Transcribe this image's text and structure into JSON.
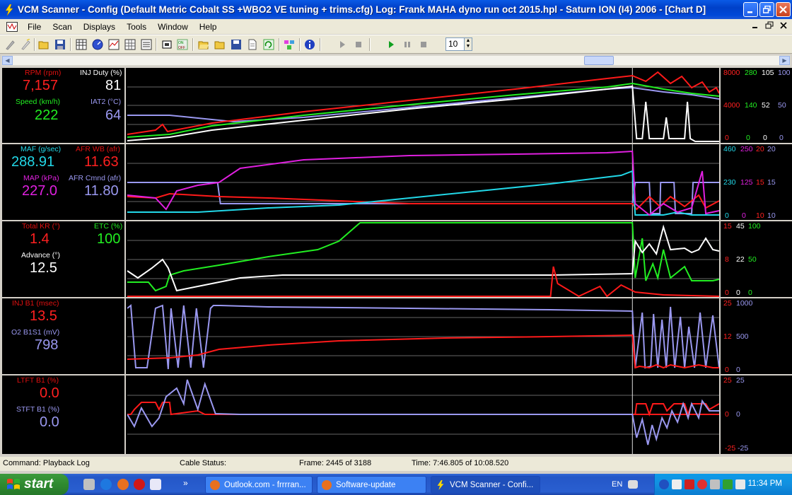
{
  "window": {
    "title": "VCM Scanner  -  Config  (Default Metric Cobalt SS +WBO2 VE tuning + trims.cfg)   Log:  Frank MAHA dyno run oct 2015.hpl   -  Saturn ION (I4) 2006 - [Chart D]"
  },
  "menu": [
    "File",
    "Scan",
    "Displays",
    "Tools",
    "Window",
    "Help"
  ],
  "toolbar": {
    "step_value": "10"
  },
  "colors": {
    "red": "#ff1a1a",
    "green": "#22ee22",
    "white": "#ffffff",
    "lavender": "#9a98f0",
    "cyan": "#22d8e8",
    "magenta": "#e020e0"
  },
  "panels": [
    {
      "readouts": [
        {
          "label": "RPM (rpm)",
          "value": "7,157",
          "color": "red"
        },
        {
          "label": "INJ Duty (%)",
          "value": "81",
          "color": "white"
        },
        {
          "label": "Speed (km/h)",
          "value": "222",
          "color": "green"
        },
        {
          "label": "IAT2 (°C)",
          "value": "64",
          "color": "lavender"
        }
      ],
      "scale": {
        "top": [
          "8000",
          "280",
          "105",
          "100"
        ],
        "mid": [
          "4000",
          "140",
          "52",
          "50"
        ],
        "bottom": [
          "0",
          "0",
          "0",
          "0"
        ]
      }
    },
    {
      "readouts": [
        {
          "label": "MAF (g/sec)",
          "value": "288.91",
          "color": "cyan"
        },
        {
          "label": "AFR WB (afr)",
          "value": "11.63",
          "color": "red"
        },
        {
          "label": "MAP (kPa)",
          "value": "227.0",
          "color": "magenta"
        },
        {
          "label": "AFR Cmnd (afr)",
          "value": "11.80",
          "color": "lavender"
        }
      ],
      "scale": {
        "top": [
          "460",
          "250",
          "20",
          "20"
        ],
        "mid": [
          "230",
          "125",
          "15",
          "15"
        ],
        "bottom": [
          "0",
          "0",
          "10",
          "10"
        ]
      }
    },
    {
      "readouts": [
        {
          "label": "Total KR (°)",
          "value": "1.4",
          "color": "red"
        },
        {
          "label": "ETC (%)",
          "value": "100",
          "color": "green"
        },
        {
          "label": "Advance (°)",
          "value": "12.5",
          "color": "white"
        }
      ],
      "scale": {
        "top": [
          "15",
          "45",
          "100"
        ],
        "mid": [
          "8",
          "22",
          "50"
        ],
        "bottom": [
          "0",
          "0",
          "0"
        ]
      }
    },
    {
      "readouts": [
        {
          "label": "INJ B1 (msec)",
          "value": "13.5",
          "color": "red"
        },
        {
          "label": "O2 B1S1 (mV)",
          "value": "798",
          "color": "lavender"
        }
      ],
      "scale": {
        "top": [
          "25",
          "1000"
        ],
        "mid": [
          "12",
          "500"
        ],
        "bottom": [
          "0",
          "0"
        ]
      }
    },
    {
      "readouts": [
        {
          "label": "LTFT B1 (%)",
          "value": "0.0",
          "color": "red"
        },
        {
          "label": "STFT B1 (%)",
          "value": "0.0",
          "color": "lavender"
        }
      ],
      "scale": {
        "top": [
          "25",
          "25"
        ],
        "mid": [
          "0",
          "0"
        ],
        "bottom": [
          "-25",
          "-25"
        ]
      }
    }
  ],
  "status": {
    "command": "Command:  Playback Log",
    "cable": "Cable Status:",
    "frame": "Frame:  2445 of 3188",
    "time": "Time:  7:46.805 of 10:08.520"
  },
  "taskbar": {
    "start": "start",
    "tasks": [
      "Outlook.com - frrrran...",
      "Software-update",
      "VCM Scanner  - Confi..."
    ],
    "lang": "EN",
    "clock": "11:34 PM"
  }
}
